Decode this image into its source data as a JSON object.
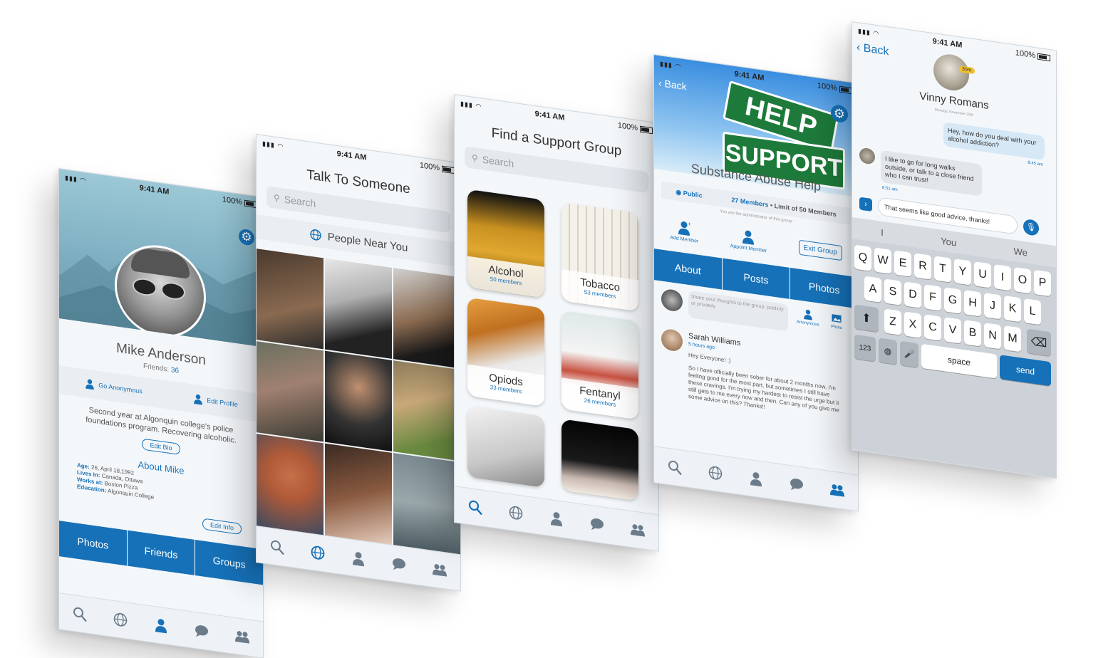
{
  "status": {
    "time": "9:41 AM",
    "battery": "100%"
  },
  "profile": {
    "name": "Mike Anderson",
    "friends_label": "Friends:",
    "friends_count": "36",
    "go_anonymous": "Go Anonymous",
    "edit_profile": "Edit Profile",
    "bio": "Second year at Algonquin college's police foundations program. Recovering alcoholic.",
    "edit_bio": "Edit Bio",
    "about_title": "About Mike",
    "about": [
      {
        "k": "Age:",
        "v": "26, April 18,1992"
      },
      {
        "k": "Lives In:",
        "v": "Canada, Ottawa"
      },
      {
        "k": "Works at:",
        "v": "Boston Pizza"
      },
      {
        "k": "Education:",
        "v": "Algonquin College"
      }
    ],
    "edit_info": "Edit Info",
    "tabs": [
      "Photos",
      "Friends",
      "Groups"
    ]
  },
  "talk": {
    "title": "Talk To Someone",
    "search_placeholder": "Search",
    "near": "People Near You"
  },
  "find": {
    "title": "Find a Support Group",
    "search_placeholder": "Search",
    "groups": [
      {
        "name": "Alcohol",
        "members": "50 members"
      },
      {
        "name": "Tobacco",
        "members": "53 members"
      },
      {
        "name": "Opiods",
        "members": "33 members"
      },
      {
        "name": "Fentanyl",
        "members": "26 members"
      }
    ]
  },
  "group": {
    "back": "Back",
    "banner_top": "HELP",
    "banner_bottom": "SUPPORT",
    "name": "Substance Abuse Help",
    "visibility": "Public",
    "members": "27 Members",
    "limit": "Limit of 50 Members",
    "admin_note": "You are the administrator of this group",
    "add_member": "Add Member",
    "appoint_member": "Appoint Member",
    "exit_group": "Exit Group",
    "tabs": [
      "About",
      "Posts",
      "Photos"
    ],
    "compose_placeholder": "Share your thoughts to the group; publicly or privately",
    "anonymous": "Anonymous",
    "photo": "Photo",
    "post_author": "Sarah Williams",
    "post_time": "5 hours ago",
    "post_greeting": "Hey Everyone! :)",
    "post_body": "So I have officially been sober for about 2 months now. I'm feeling good for the most part, but sometimes I still have these cravings. I'm trying my hardest to resist the urge but it still gets to me every now and then. Can any of you give me some advice on this? Thanks!!"
  },
  "chat": {
    "back": "Back",
    "name": "Vinny Romans",
    "badge": "30m",
    "date": "Monday, November 20th",
    "msg_out": "Hey, how do you deal with your alcohol addiction?",
    "msg_out_time": "8:45 am",
    "msg_in": "I like to go for long walks outside, or talk to a close friend who I can trust!",
    "msg_in_time": "8:51 am",
    "draft": "That seems like good advice, thanks!",
    "suggestions": [
      "I",
      "You",
      "We"
    ],
    "row1": [
      "Q",
      "W",
      "E",
      "R",
      "T",
      "Y",
      "U",
      "I",
      "O",
      "P"
    ],
    "row2": [
      "A",
      "S",
      "D",
      "F",
      "G",
      "H",
      "J",
      "K",
      "L"
    ],
    "row3": [
      "Z",
      "X",
      "C",
      "V",
      "B",
      "N",
      "M"
    ],
    "num_key": "123",
    "space": "space",
    "send": "send"
  }
}
